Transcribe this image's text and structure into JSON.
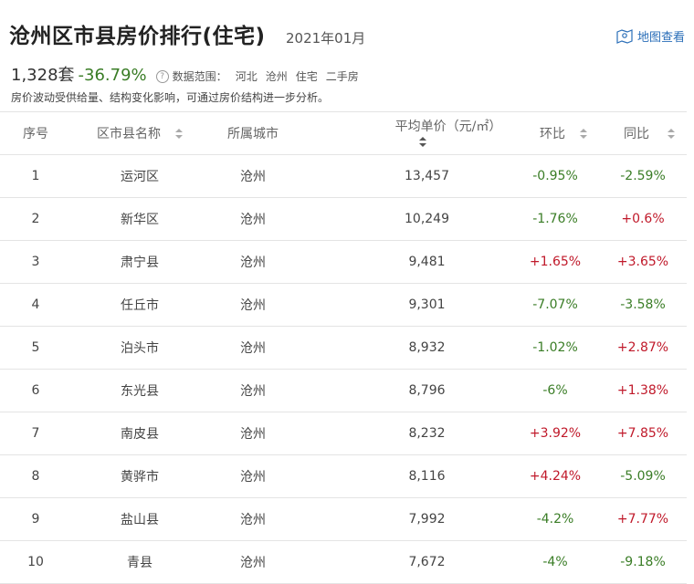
{
  "header": {
    "title": "沧州区市县房价排行(住宅)",
    "date": "2021年01月",
    "map_view": "地图查看"
  },
  "summary": {
    "count": "1,328套",
    "change": "-36.79%",
    "scope_label": "数据范围：",
    "scope": [
      "河北",
      "沧州",
      "住宅",
      "二手房"
    ],
    "note": "房价波动受供给量、结构变化影响，可通过房价结构进一步分析。"
  },
  "table": {
    "columns": [
      "序号",
      "区市县名称",
      "所属城市",
      "平均单价（元/㎡）",
      "环比",
      "同比"
    ],
    "rows": [
      {
        "rank": "1",
        "district": "运河区",
        "city": "沧州",
        "price": "13,457",
        "mom": "-0.95%",
        "yoy": "-2.59%"
      },
      {
        "rank": "2",
        "district": "新华区",
        "city": "沧州",
        "price": "10,249",
        "mom": "-1.76%",
        "yoy": "+0.6%"
      },
      {
        "rank": "3",
        "district": "肃宁县",
        "city": "沧州",
        "price": "9,481",
        "mom": "+1.65%",
        "yoy": "+3.65%"
      },
      {
        "rank": "4",
        "district": "任丘市",
        "city": "沧州",
        "price": "9,301",
        "mom": "-7.07%",
        "yoy": "-3.58%"
      },
      {
        "rank": "5",
        "district": "泊头市",
        "city": "沧州",
        "price": "8,932",
        "mom": "-1.02%",
        "yoy": "+2.87%"
      },
      {
        "rank": "6",
        "district": "东光县",
        "city": "沧州",
        "price": "8,796",
        "mom": "-6%",
        "yoy": "+1.38%"
      },
      {
        "rank": "7",
        "district": "南皮县",
        "city": "沧州",
        "price": "8,232",
        "mom": "+3.92%",
        "yoy": "+7.85%"
      },
      {
        "rank": "8",
        "district": "黄骅市",
        "city": "沧州",
        "price": "8,116",
        "mom": "+4.24%",
        "yoy": "-5.09%"
      },
      {
        "rank": "9",
        "district": "盐山县",
        "city": "沧州",
        "price": "7,992",
        "mom": "-4.2%",
        "yoy": "+7.77%"
      },
      {
        "rank": "10",
        "district": "青县",
        "city": "沧州",
        "price": "7,672",
        "mom": "-4%",
        "yoy": "-9.18%"
      }
    ]
  },
  "colors": {
    "up": "#c0192a",
    "down": "#3a7d26",
    "link": "#2a6eb8"
  }
}
